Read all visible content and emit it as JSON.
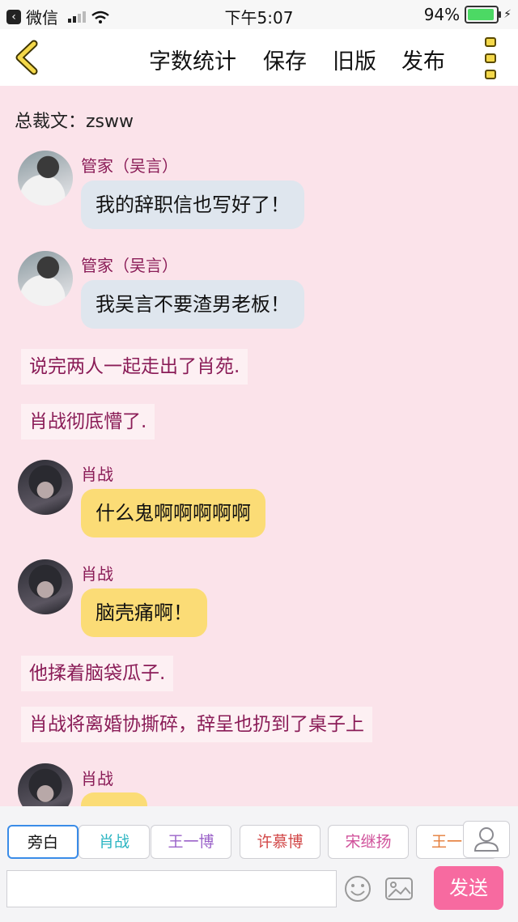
{
  "status_bar": {
    "carrier": "微信",
    "time": "下午5:07",
    "battery": "94%",
    "battery_level": 0.94
  },
  "nav": {
    "items": [
      "字数统计",
      "保存",
      "旧版",
      "发布"
    ]
  },
  "chat": {
    "title": "总裁文：zsww",
    "messages": [
      {
        "speaker": "管家（吴言）",
        "text": "我的辞职信也写好了！"
      },
      {
        "speaker": "管家（吴言）",
        "text": "我吴言不要渣男老板！"
      },
      {
        "narration": "说完两人一起走出了肖苑."
      },
      {
        "narration": "肖战彻底懵了."
      },
      {
        "speaker": "肖战",
        "text": "什么鬼啊啊啊啊啊"
      },
      {
        "speaker": "肖战",
        "text": "脑壳痛啊！"
      },
      {
        "narration": "他揉着脑袋瓜子."
      },
      {
        "narration": "肖战将离婚协撕碎，辞呈也扔到了桌子上"
      },
      {
        "speaker": "肖战",
        "text": ""
      }
    ]
  },
  "roles": [
    "旁白",
    "肖战",
    "王一博",
    "许慕博",
    "宋继扬",
    "王一"
  ],
  "input": {
    "placeholder": "",
    "send_label": "发送"
  },
  "colors": {
    "background": "#fbe3ea",
    "send": "#f76aa0",
    "bubble_blue": "#dfe6ee",
    "bubble_yellow": "#fbdc76",
    "name": "#8a1c57"
  }
}
